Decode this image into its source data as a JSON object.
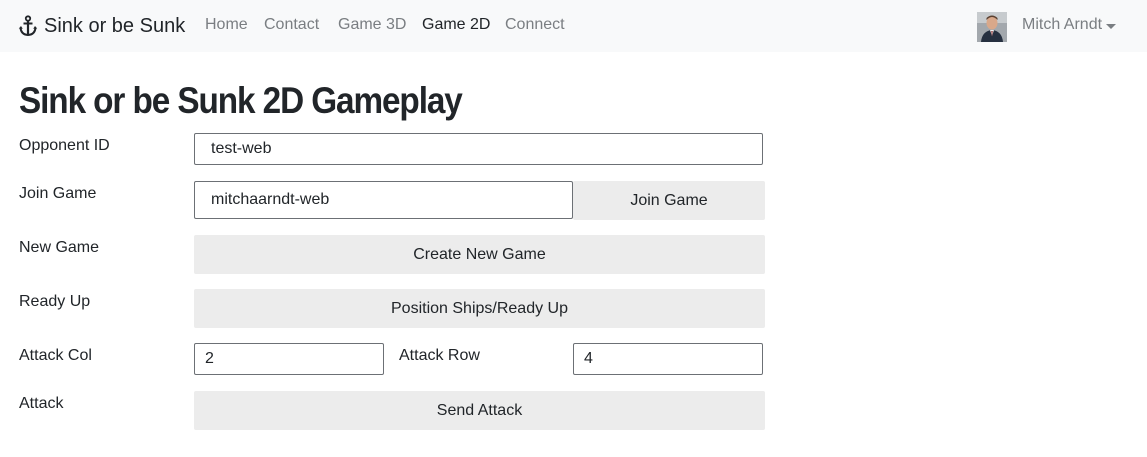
{
  "nav": {
    "brand": "Sink or be Sunk",
    "brand_icon": "anchor-icon",
    "links": [
      {
        "label": "Home",
        "active": false
      },
      {
        "label": "Contact",
        "active": false
      },
      {
        "label": "Game 3D",
        "active": false
      },
      {
        "label": "Game 2D",
        "active": true
      },
      {
        "label": "Connect",
        "active": false
      }
    ],
    "user_name": "Mitch Arndt"
  },
  "page": {
    "title": "Sink or be Sunk 2D Gameplay"
  },
  "form": {
    "opponent_label": "Opponent ID",
    "opponent_value": "test-web",
    "join_label": "Join Game",
    "join_value": "mitchaarndt-web",
    "join_button": "Join Game",
    "new_game_label": "New Game",
    "new_game_button": "Create New Game",
    "ready_label": "Ready Up",
    "ready_button": "Position Ships/Ready Up",
    "attack_col_label": "Attack Col",
    "attack_col_value": "2",
    "attack_row_label": "Attack Row",
    "attack_row_value": "4",
    "attack_label": "Attack",
    "attack_button": "Send Attack"
  },
  "colors": {
    "navbar_bg": "#f8f9fa",
    "nav_muted": "#7a7e82",
    "text": "#212529",
    "button_bg": "#ececec"
  }
}
